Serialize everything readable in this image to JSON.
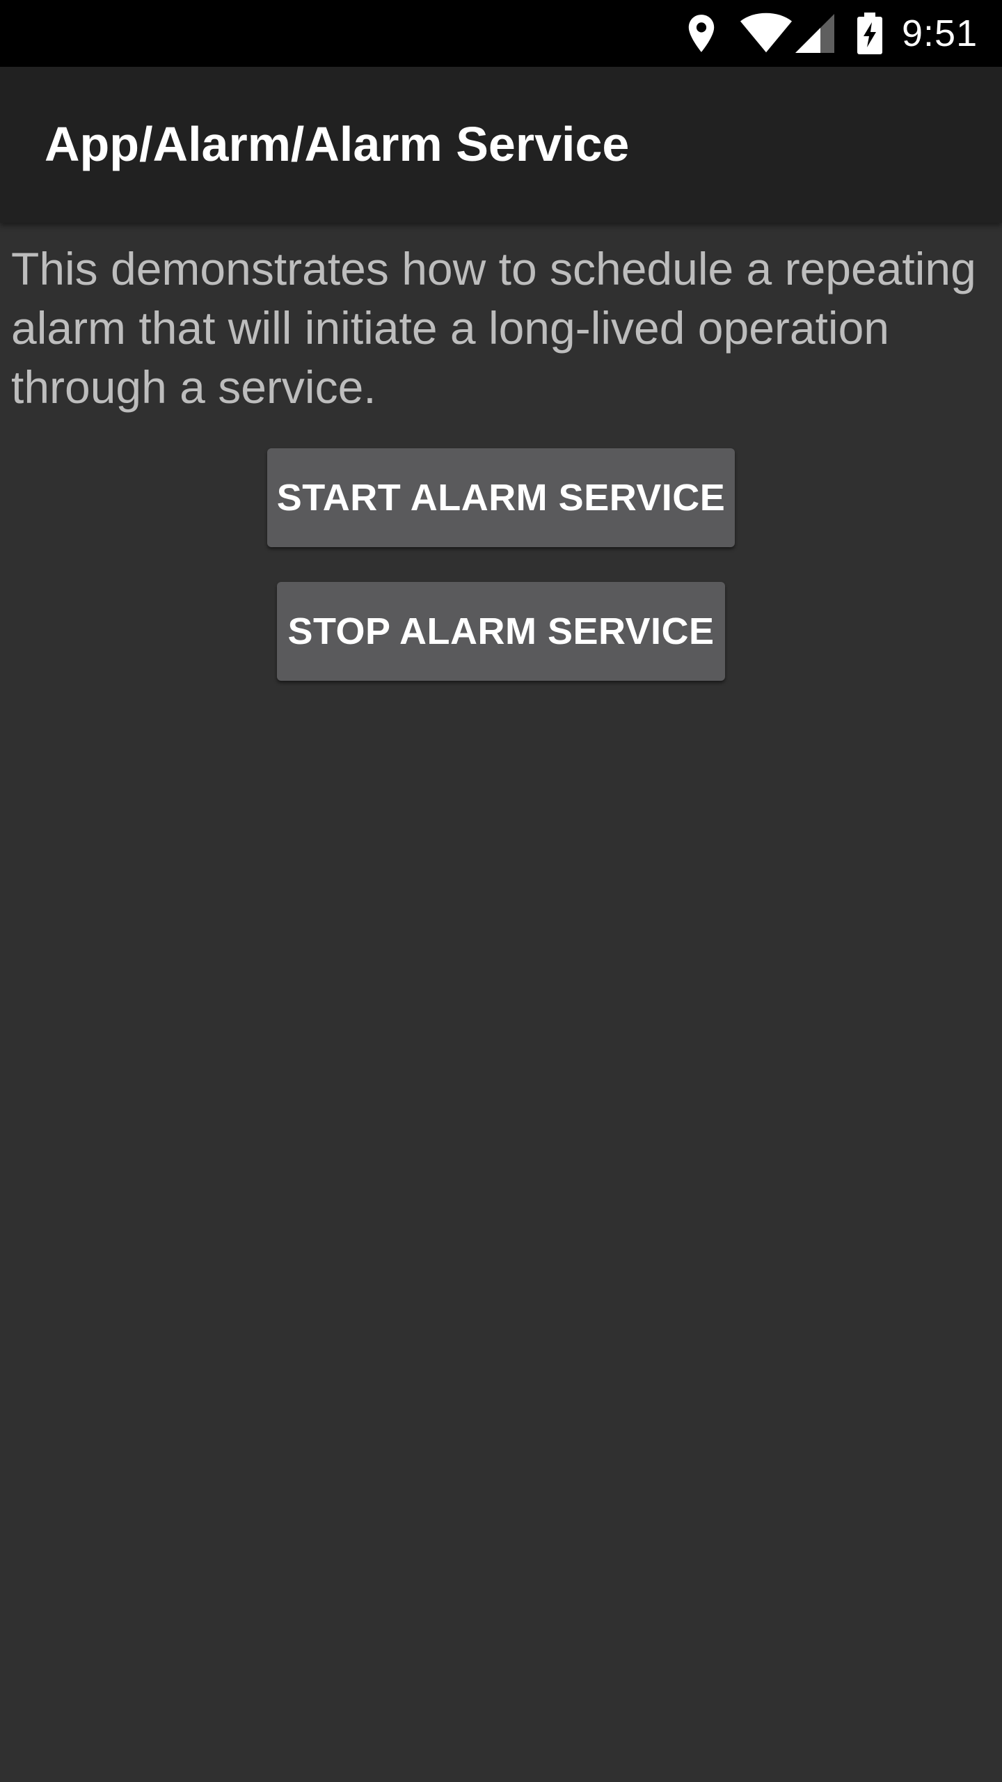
{
  "status_bar": {
    "time": "9:51",
    "icons": [
      "location-icon",
      "wifi-icon",
      "signal-icon",
      "battery-charging-icon"
    ]
  },
  "app_bar": {
    "title": "App/Alarm/Alarm Service"
  },
  "content": {
    "description": "This demonstrates how to schedule a repeating alarm that will initiate a long-lived operation through a service.",
    "start_button_label": "START ALARM SERVICE",
    "stop_button_label": "STOP ALARM SERVICE"
  },
  "colors": {
    "status_bar_bg": "#000000",
    "app_bar_bg": "#212121",
    "background": "#303030",
    "button_bg": "#5a5a5c",
    "description_text": "#bdbdbd"
  }
}
